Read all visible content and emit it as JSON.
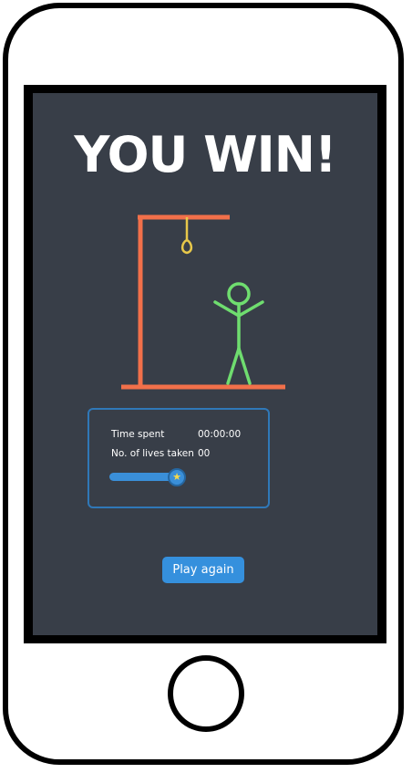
{
  "game": {
    "result_title": "YOU WIN!"
  },
  "stats": {
    "time_label": "Time spent",
    "time_value": "00:00:00",
    "lives_label": "No. of lives taken",
    "lives_value": "00",
    "progress_fraction": 1.0,
    "progress_icon": "star-icon"
  },
  "actions": {
    "play_again_label": "Play again"
  },
  "colors": {
    "screen_bg": "#383e48",
    "gallows": "#f2704a",
    "noose": "#e8c84a",
    "stick_figure": "#6fdd6f",
    "accent_blue": "#3590dd",
    "star": "#f5d84a"
  }
}
